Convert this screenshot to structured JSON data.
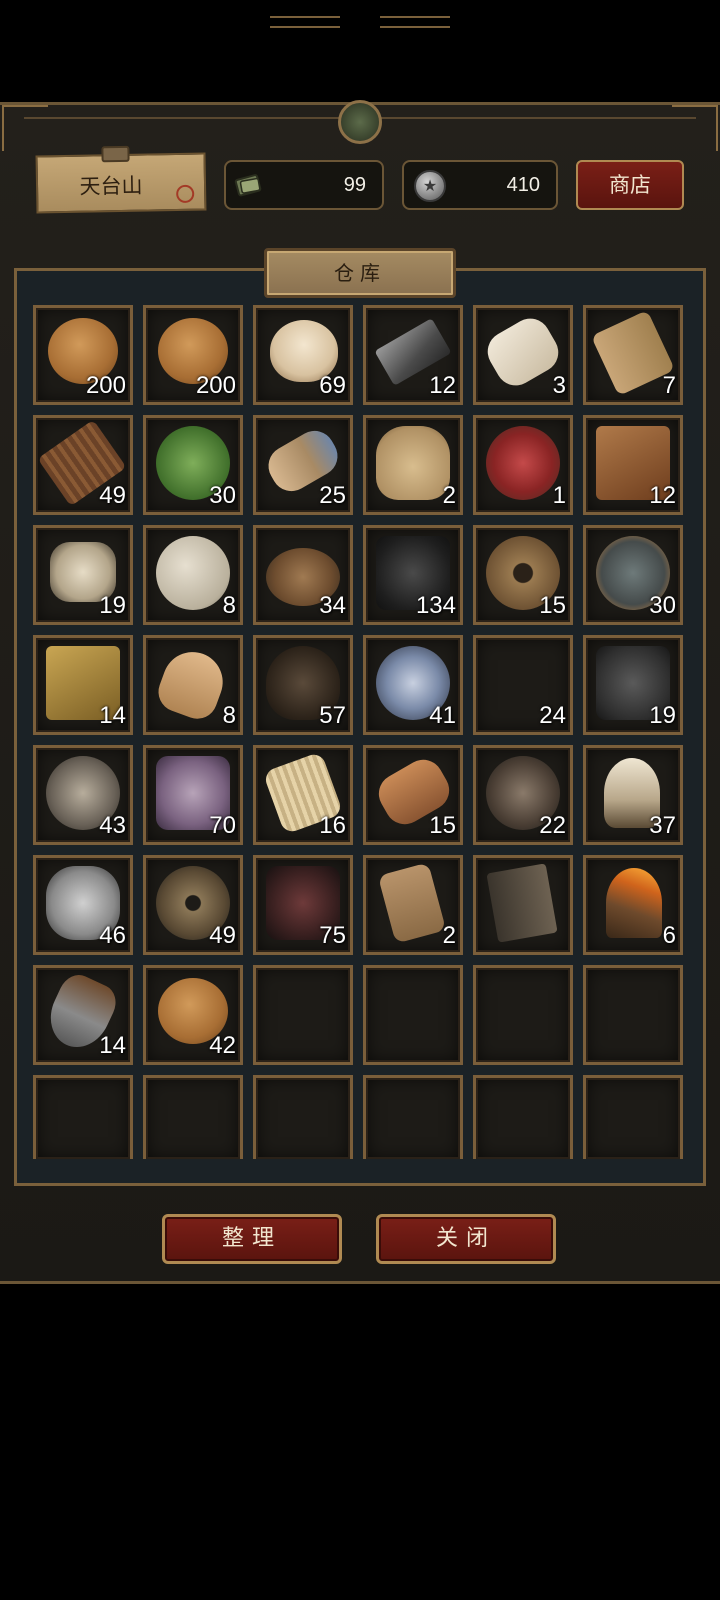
{
  "header": {
    "location": "天台山",
    "ticket_count": "99",
    "coin_count": "410",
    "coin_symbol": "★",
    "shop_label": "商店"
  },
  "panel": {
    "title": "仓库"
  },
  "items": [
    {
      "icon": "pancake-icon",
      "art": "cake",
      "count": "200"
    },
    {
      "icon": "pancake-icon",
      "art": "cake",
      "count": "200"
    },
    {
      "icon": "steamed-bun-icon",
      "art": "bun",
      "count": "69"
    },
    {
      "icon": "iron-ingot-icon",
      "art": "ingot",
      "count": "12"
    },
    {
      "icon": "cloth-bolt-icon",
      "art": "cloth",
      "count": "3"
    },
    {
      "icon": "hemp-roll-icon",
      "art": "roll",
      "count": "7"
    },
    {
      "icon": "firewood-bundle-icon",
      "art": "sticks",
      "count": "49"
    },
    {
      "icon": "herb-leaf-icon",
      "art": "leaf",
      "count": "30"
    },
    {
      "icon": "root-bundle-icon",
      "art": "root",
      "count": "25"
    },
    {
      "icon": "grain-sack-icon",
      "art": "sack",
      "count": "2"
    },
    {
      "icon": "raw-meat-icon",
      "art": "meat",
      "count": "1"
    },
    {
      "icon": "brown-block-icon",
      "art": "block",
      "count": "12"
    },
    {
      "icon": "bones-icon",
      "art": "bone",
      "count": "19"
    },
    {
      "icon": "yarn-ball-icon",
      "art": "yarn",
      "count": "8"
    },
    {
      "icon": "soil-bowl-icon",
      "art": "dust",
      "count": "34"
    },
    {
      "icon": "coal-icon",
      "art": "coal",
      "count": "134"
    },
    {
      "icon": "rope-coil-icon",
      "art": "rope",
      "count": "15"
    },
    {
      "icon": "beans-bowl-icon",
      "art": "beans",
      "count": "30"
    },
    {
      "icon": "gold-bars-icon",
      "art": "gold",
      "count": "14"
    },
    {
      "icon": "ginseng-icon",
      "art": "ginseng",
      "count": "8"
    },
    {
      "icon": "dark-shell-icon",
      "art": "shell",
      "count": "57"
    },
    {
      "icon": "cobweb-bundle-icon",
      "art": "web",
      "count": "41"
    },
    {
      "icon": "empty-slot-icon",
      "art": "empty",
      "count": "24"
    },
    {
      "icon": "iron-ore-icon",
      "art": "ore",
      "count": "19"
    },
    {
      "icon": "animal-pelt-icon",
      "art": "fur",
      "count": "43"
    },
    {
      "icon": "crystal-ore-icon",
      "art": "crystal",
      "count": "70"
    },
    {
      "icon": "straw-bundle-icon",
      "art": "straw",
      "count": "16"
    },
    {
      "icon": "wood-log-icon",
      "art": "log",
      "count": "15"
    },
    {
      "icon": "fur-tuft-icon",
      "art": "hair",
      "count": "22"
    },
    {
      "icon": "beast-claw-icon",
      "art": "claw",
      "count": "37"
    },
    {
      "icon": "silk-cocoon-icon",
      "art": "silk",
      "count": "46"
    },
    {
      "icon": "gears-icon",
      "art": "gears",
      "count": "49"
    },
    {
      "icon": "red-rock-icon",
      "art": "rock",
      "count": "75"
    },
    {
      "icon": "mountain-token-icon",
      "art": "token",
      "count": "2"
    },
    {
      "icon": "old-book-icon",
      "art": "book",
      "count": ""
    },
    {
      "icon": "torch-icon",
      "art": "torch",
      "count": "6"
    },
    {
      "icon": "shovel-icon",
      "art": "shovel",
      "count": "14"
    },
    {
      "icon": "pancake-icon",
      "art": "cake",
      "count": "42"
    },
    {
      "icon": "",
      "art": "empty",
      "count": ""
    },
    {
      "icon": "",
      "art": "empty",
      "count": ""
    },
    {
      "icon": "",
      "art": "empty",
      "count": ""
    },
    {
      "icon": "",
      "art": "empty",
      "count": ""
    },
    {
      "icon": "",
      "art": "empty",
      "count": ""
    },
    {
      "icon": "",
      "art": "empty",
      "count": ""
    },
    {
      "icon": "",
      "art": "empty",
      "count": ""
    },
    {
      "icon": "",
      "art": "empty",
      "count": ""
    },
    {
      "icon": "",
      "art": "empty",
      "count": ""
    },
    {
      "icon": "",
      "art": "empty",
      "count": ""
    }
  ],
  "footer": {
    "sort_label": "整理",
    "close_label": "关闭"
  }
}
